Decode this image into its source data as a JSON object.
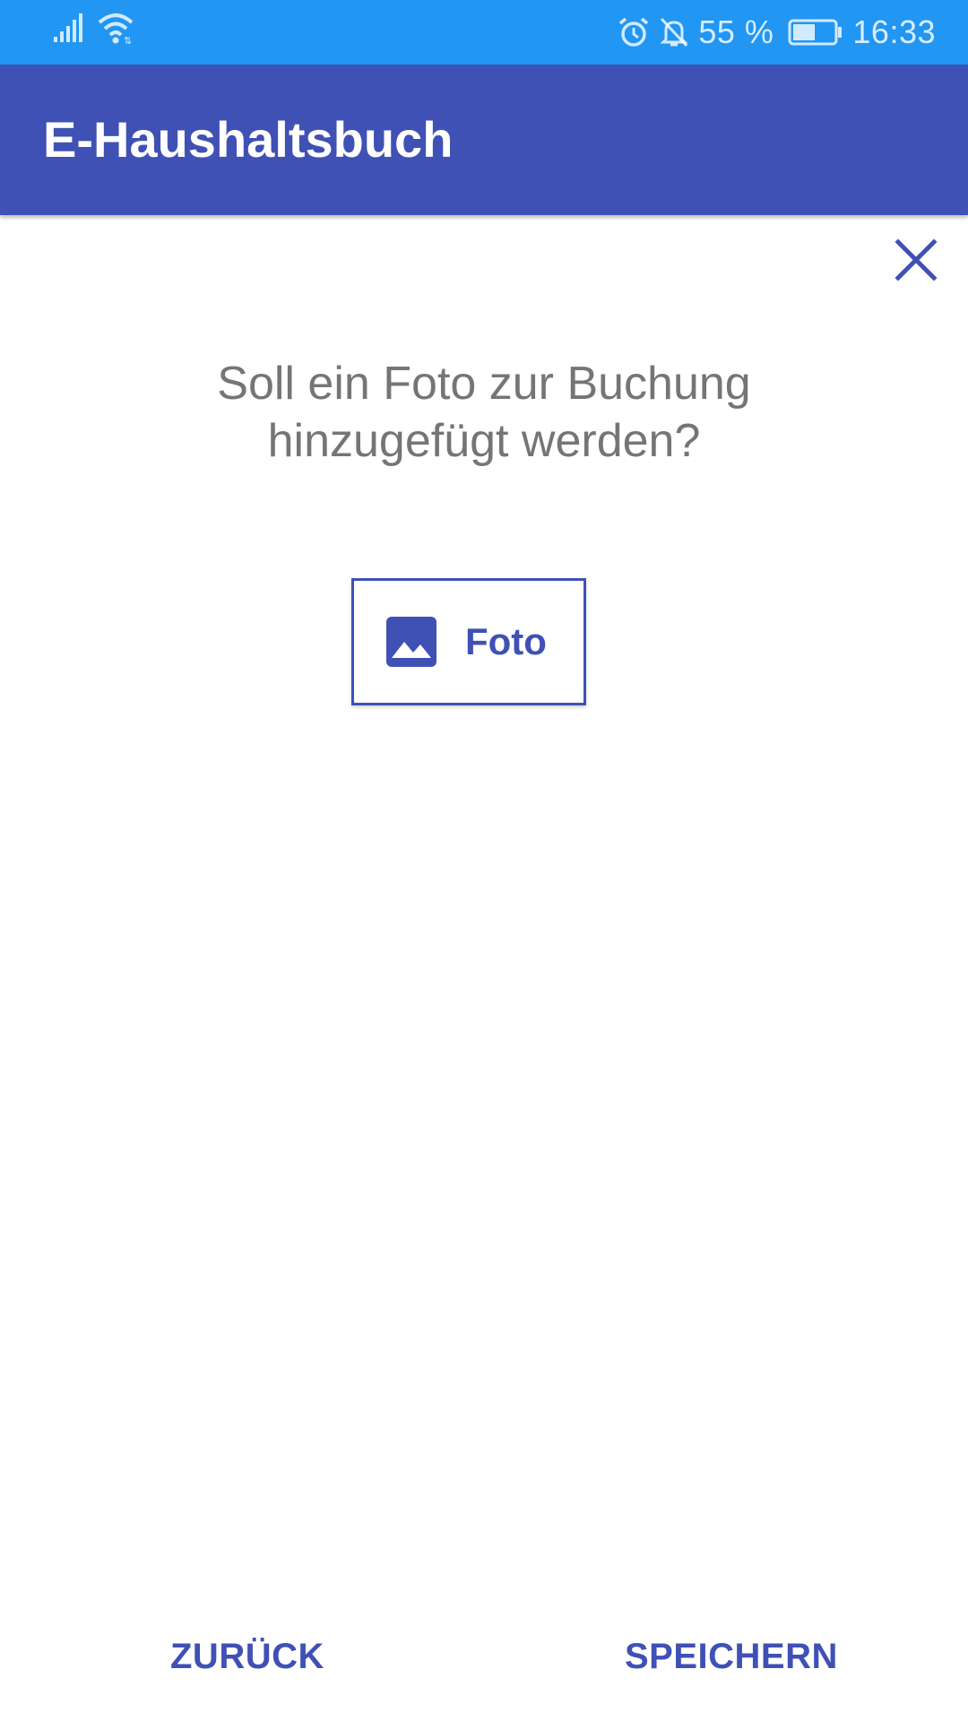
{
  "status_bar": {
    "battery_percent": "55 %",
    "time": "16:33",
    "icons": [
      "signal-icon",
      "wifi-icon",
      "alarm-icon",
      "notifications-off-icon",
      "battery-icon"
    ],
    "battery_level": 0.55
  },
  "app_bar": {
    "title": "E-Haushaltsbuch"
  },
  "dialog": {
    "close_icon": "close-icon",
    "question": "Soll ein Foto zur Buchung hinzugefügt werden?",
    "photo_button": {
      "label": "Foto",
      "icon": "image-icon"
    }
  },
  "actions": {
    "back_label": "ZURÜCK",
    "save_label": "SPEICHERN"
  },
  "colors": {
    "status_bar": "#2196F3",
    "primary": "#3F51B5",
    "text_secondary": "#757575",
    "background": "#FFFFFF"
  }
}
